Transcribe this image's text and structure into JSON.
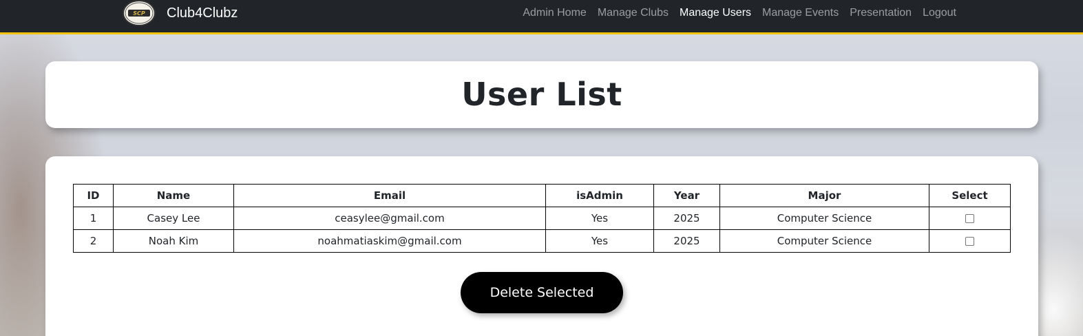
{
  "navbar": {
    "brand": "Club4Clubz",
    "links": [
      {
        "label": "Admin Home",
        "active": false
      },
      {
        "label": "Manage Clubs",
        "active": false
      },
      {
        "label": "Manage Users",
        "active": true
      },
      {
        "label": "Manage Events",
        "active": false
      },
      {
        "label": "Presentation",
        "active": false
      },
      {
        "label": "Logout",
        "active": false
      }
    ]
  },
  "page": {
    "title": "User List"
  },
  "table": {
    "headers": [
      "ID",
      "Name",
      "Email",
      "isAdmin",
      "Year",
      "Major",
      "Select"
    ],
    "rows": [
      {
        "id": "1",
        "name": "Casey Lee",
        "email": "ceasylee@gmail.com",
        "is_admin": "Yes",
        "year": "2025",
        "major": "Computer Science",
        "selected": false
      },
      {
        "id": "2",
        "name": "Noah Kim",
        "email": "noahmatiaskim@gmail.com",
        "is_admin": "Yes",
        "year": "2025",
        "major": "Computer Science",
        "selected": false
      }
    ]
  },
  "actions": {
    "delete_label": "Delete Selected"
  },
  "colors": {
    "navbar": "#212529",
    "accent": "#f1c40f",
    "button": "#000000"
  }
}
